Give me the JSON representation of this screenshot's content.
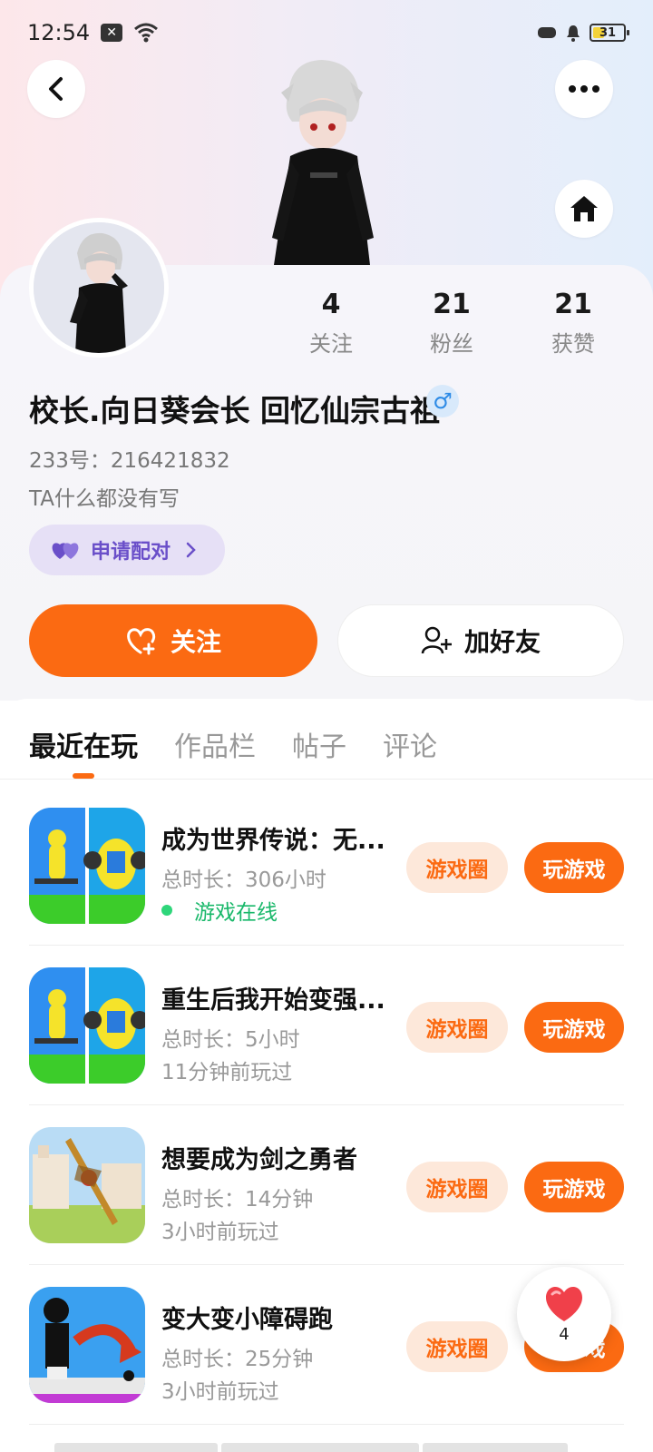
{
  "status_bar": {
    "time": "12:54",
    "battery": "31",
    "icons": [
      "notification-box-icon",
      "wifi-icon",
      "game-controller-icon",
      "bell-icon",
      "battery-icon"
    ]
  },
  "header": {
    "back_icon": "chevron-left-icon",
    "more_icon": "more-dots-icon",
    "home_icon": "home-icon"
  },
  "profile": {
    "stats": [
      {
        "value": "4",
        "label": "关注"
      },
      {
        "value": "21",
        "label": "粉丝"
      },
      {
        "value": "21",
        "label": "获赞"
      }
    ],
    "name": "校长.向日葵会长 回忆仙宗古祖",
    "gender_symbol": "♂",
    "uid": "233号：216421832",
    "bio": "TA什么都没有写",
    "match_label": "申请配对",
    "follow_label": "关注",
    "add_friend_label": "加好友"
  },
  "tabs": [
    {
      "label": "最近在玩",
      "active": true
    },
    {
      "label": "作品栏",
      "active": false
    },
    {
      "label": "帖子",
      "active": false
    },
    {
      "label": "评论",
      "active": false
    }
  ],
  "games": [
    {
      "title": "成为世界传说：无...",
      "duration": "总时长：306小时",
      "status": "游戏在线",
      "online": true,
      "circle_label": "游戏圈",
      "play_label": "玩游戏"
    },
    {
      "title": "重生后我开始变强...",
      "duration": "总时长：5小时",
      "status": "11分钟前玩过",
      "online": false,
      "circle_label": "游戏圈",
      "play_label": "玩游戏"
    },
    {
      "title": "想要成为剑之勇者",
      "duration": "总时长：14分钟",
      "status": "3小时前玩过",
      "online": false,
      "circle_label": "游戏圈",
      "play_label": "玩游戏"
    },
    {
      "title": "变大变小障碍跑",
      "duration": "总时长：25分钟",
      "status": "3小时前玩过",
      "online": false,
      "circle_label": "游戏圈",
      "play_label": "玩游戏"
    }
  ],
  "floating_like": {
    "count": "4",
    "icon": "heart-icon"
  },
  "colors": {
    "accent": "#fb6a12",
    "online": "#19b86a",
    "match": "#6a4fc9"
  }
}
